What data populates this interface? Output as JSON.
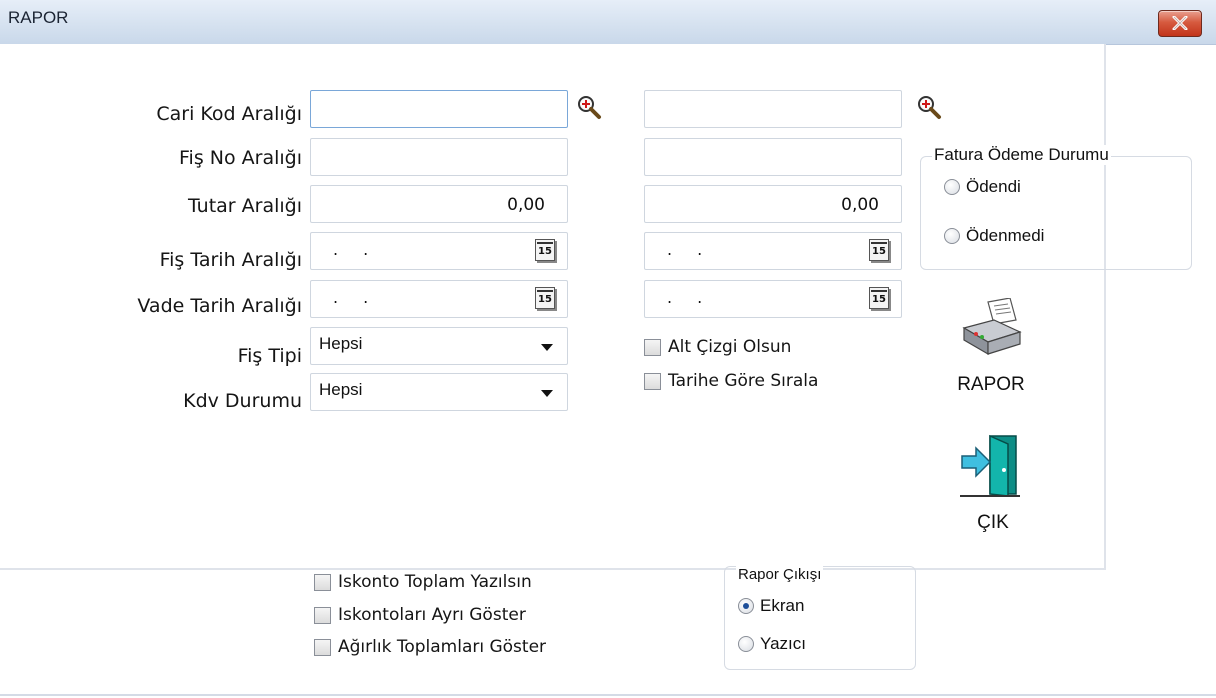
{
  "window": {
    "title": "RAPOR"
  },
  "form": {
    "cari_kod": {
      "label": "Cari Kod Aralığı",
      "from": "",
      "to": ""
    },
    "fis_no": {
      "label": "Fiş No Aralığı",
      "from": "",
      "to": ""
    },
    "tutar": {
      "label": "Tutar Aralığı",
      "from": "0,00",
      "to": "0,00"
    },
    "fis_tarih": {
      "label": "Fiş Tarih Aralığı",
      "from": ". .",
      "to": ". .",
      "calendar_label": "15"
    },
    "vade_tarih": {
      "label": "Vade Tarih Aralığı",
      "from": ". .",
      "to": ". .",
      "calendar_label": "15"
    },
    "fis_tipi": {
      "label": "Fiş Tipi",
      "value": "Hepsi"
    },
    "kdv_durumu": {
      "label": "Kdv Durumu",
      "value": "Hepsi"
    }
  },
  "options": {
    "alt_cizgi": "Alt Çizgi Olsun",
    "tarihe_gore": "Tarihe Göre Sırala"
  },
  "fatura_odeme": {
    "title": "Fatura Ödeme Durumu",
    "odendi": "Ödendi",
    "odenmedi": "Ödenmedi"
  },
  "buttons": {
    "rapor": "RAPOR",
    "cik": "ÇIK"
  },
  "bottom_options": {
    "iskonto_toplam": "Iskonto Toplam Yazılsın",
    "iskonto_ayri": "Iskontoları Ayrı Göster",
    "agirlik": "Ağırlık Toplamları Göster"
  },
  "rapor_cikisi": {
    "title": "Rapor Çıkışı",
    "ekran": "Ekran",
    "yazici": "Yazıcı",
    "selected": "Ekran"
  },
  "icons": {
    "lookup": "magnifier-plus-icon",
    "calendar": "calendar-icon",
    "printer": "printer-icon",
    "exit": "exit-door-icon",
    "close": "close-icon"
  }
}
